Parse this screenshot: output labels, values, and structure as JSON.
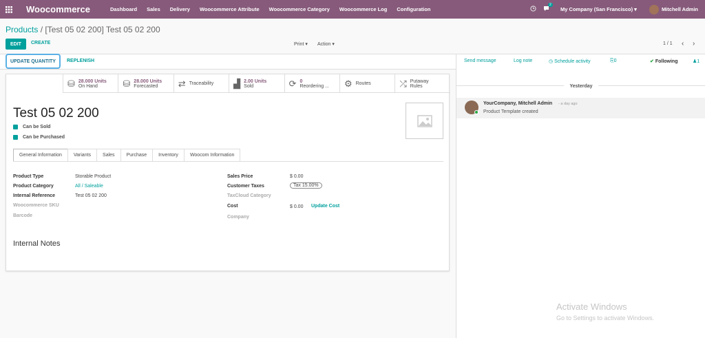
{
  "topbar": {
    "brand": "Woocommerce",
    "menu": [
      "Dashboard",
      "Sales",
      "Delivery",
      "Woocommerce Attribute",
      "Woocommerce Category",
      "Woocommerce Log",
      "Configuration"
    ],
    "chat_count": "2",
    "company": "My Company (San Francisco)",
    "user": "Mitchell Admin",
    "color": "#875a7b"
  },
  "breadcrumb": {
    "root": "Products",
    "sep": "/",
    "current": "[Test 05 02 200] Test 05 02 200"
  },
  "controls": {
    "edit": "EDIT",
    "create": "CREATE",
    "print": "Print",
    "action": "Action",
    "pager": "1 / 1"
  },
  "status": {
    "update_quantity": "UPDATE QUANTITY",
    "replenish": "REPLENISH"
  },
  "smart_buttons": [
    {
      "icon": "cubes-icon",
      "value": "28.000 Units",
      "label": "On Hand"
    },
    {
      "icon": "cubes-icon",
      "value": "28.000 Units",
      "label": "Forecasted"
    },
    {
      "icon": "arrows-icon",
      "value": "",
      "label": "Traceability"
    },
    {
      "icon": "bar-chart-icon",
      "value": "2.00 Units",
      "label": "Sold"
    },
    {
      "icon": "refresh-icon",
      "value": "0",
      "label": "Reordering ..."
    },
    {
      "icon": "cogs-icon",
      "value": "",
      "label": "Routes"
    },
    {
      "icon": "random-icon",
      "value": "",
      "label": "Putaway Rules"
    }
  ],
  "product": {
    "name": "Test 05 02 200",
    "can_be_sold": "Can be Sold",
    "can_be_purchased": "Can be Purchased"
  },
  "tabs": [
    "General Information",
    "Variants",
    "Sales",
    "Purchase",
    "Inventory",
    "Woocom Information"
  ],
  "left_fields": [
    {
      "label": "Product Type",
      "value": "Storable Product"
    },
    {
      "label": "Product Category",
      "value": "All / Saleable"
    },
    {
      "label": "Internal Reference",
      "value": "Test 05 02 200"
    },
    {
      "label": "Woocommerce SKU",
      "value": ""
    },
    {
      "label": "Barcode",
      "value": ""
    }
  ],
  "right_fields": {
    "sales_price_label": "Sales Price",
    "sales_price": "$ 0.00",
    "taxes_label": "Customer Taxes",
    "taxes": "Tax 15.00%",
    "taxcloud_label": "TaxCloud Category",
    "cost_label": "Cost",
    "cost": "$ 0.00",
    "update_cost": "Update Cost",
    "company_label": "Company"
  },
  "internal_notes": "Internal Notes",
  "chatter": {
    "send_message": "Send message",
    "log_note": "Log note",
    "schedule": "Schedule activity",
    "attachments": "0",
    "following": "Following",
    "followers": "1",
    "day": "Yesterday",
    "author": "YourCompany, Mitchell Admin",
    "time": "- a day ago",
    "body": "Product Template created"
  },
  "watermark": {
    "line1": "Activate Windows",
    "line2": "Go to Settings to activate Windows."
  }
}
